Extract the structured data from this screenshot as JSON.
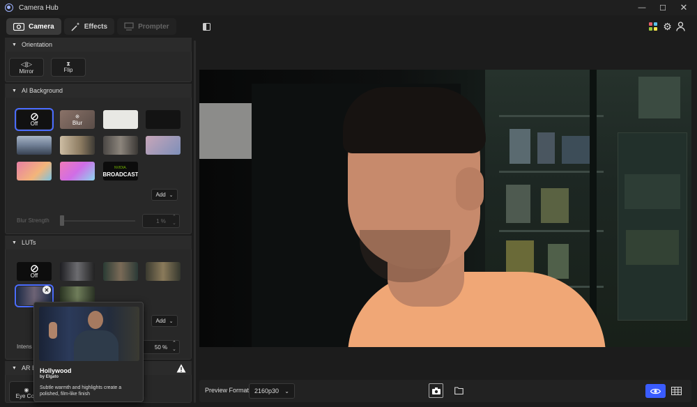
{
  "window": {
    "title": "Camera Hub"
  },
  "tabs": [
    {
      "label": "Camera",
      "icon": "camera-icon"
    },
    {
      "label": "Effects",
      "icon": "magic-wand-icon"
    },
    {
      "label": "Prompter",
      "icon": "prompter-icon"
    }
  ],
  "orientation": {
    "header": "Orientation",
    "mirror_label": "Mirror",
    "flip_label": "Flip"
  },
  "ai_background": {
    "header": "AI Background",
    "off_label": "Off",
    "blur_label": "Blur",
    "nvidia_brand": "NVIDIA.",
    "broadcast_label": "BROADCAST",
    "add_label": "Add",
    "blur_strength_label": "Blur Strength",
    "blur_strength_value": "1 %"
  },
  "luts": {
    "header": "LUTs",
    "off_label": "Off",
    "add_label": "Add",
    "intensity_label": "Intens",
    "intensity_value": "50 %"
  },
  "ar_effects": {
    "header": "AR E",
    "eye_contact_label": "Eye Con"
  },
  "tooltip": {
    "title": "Hollywood",
    "byline": "by Elgato",
    "description": "Subtle warmth and highlights create a polished, film-like finish"
  },
  "bottom": {
    "preview_format_label": "Preview Format",
    "preview_format_value": "2160p30"
  },
  "colors": {
    "accent": "#4a6cff",
    "active_toggle": "#3a5cff"
  }
}
